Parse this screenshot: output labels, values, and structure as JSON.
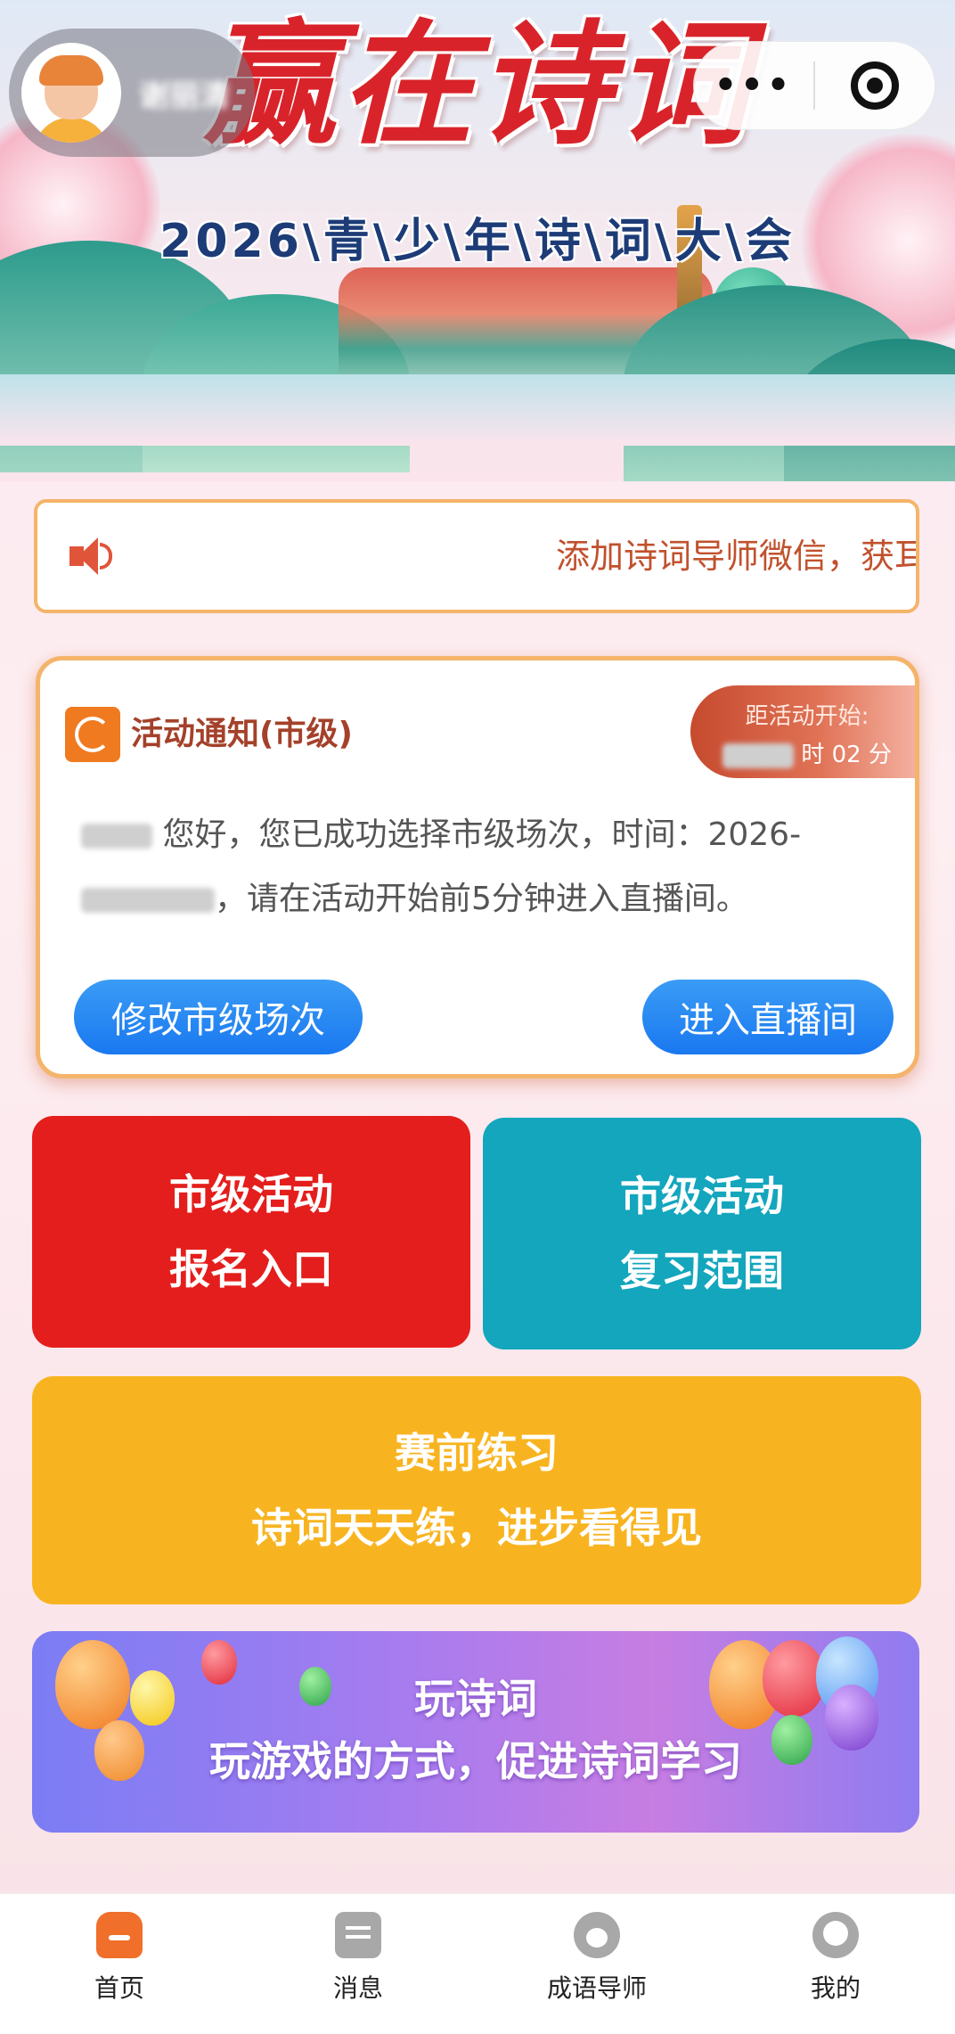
{
  "banner": {
    "title": "赢在诗词",
    "subtitle": "2026\\青\\少\\年\\诗\\词\\大\\会"
  },
  "user": {
    "name": "谢丽清"
  },
  "capsule": {
    "more_icon": "more-icon",
    "close_icon": "target-icon"
  },
  "marquee": {
    "icon": "speaker-icon",
    "text": "添加诗词导师微信，获耳"
  },
  "notice": {
    "icon": "notice-icon",
    "title": "活动通知(市级)",
    "countdown_label": "距活动开始:",
    "countdown_time": "时 02 分",
    "greeting": "您好，您已成功选择市级场次，时间：2026-",
    "body_rest": "，请在活动开始前5分钟进入直播间。",
    "modify_button": "修改市级场次",
    "live_button": "进入直播间"
  },
  "tiles": {
    "signup": {
      "line1": "市级活动",
      "line2": "报名入口",
      "color": "#e41e1c"
    },
    "review": {
      "line1": "市级活动",
      "line2": "复习范围",
      "color": "#13a6bd"
    },
    "practice": {
      "line1": "赛前练习",
      "line2": "诗词天天练，进步看得见",
      "color": "#f8b420"
    },
    "game": {
      "line1": "玩诗词",
      "line2": "玩游戏的方式，促进诗词学习"
    }
  },
  "nav": {
    "items": [
      {
        "label": "首页",
        "icon": "home-icon",
        "active": true
      },
      {
        "label": "消息",
        "icon": "message-icon",
        "active": false
      },
      {
        "label": "成语导师",
        "icon": "tutor-icon",
        "active": false
      },
      {
        "label": "我的",
        "icon": "profile-icon",
        "active": false
      }
    ]
  },
  "colors": {
    "accent": "#f06f2a",
    "primary_blue": "#1a78f0",
    "notice_border": "#f4b46a",
    "title_red": "#d9232a"
  }
}
